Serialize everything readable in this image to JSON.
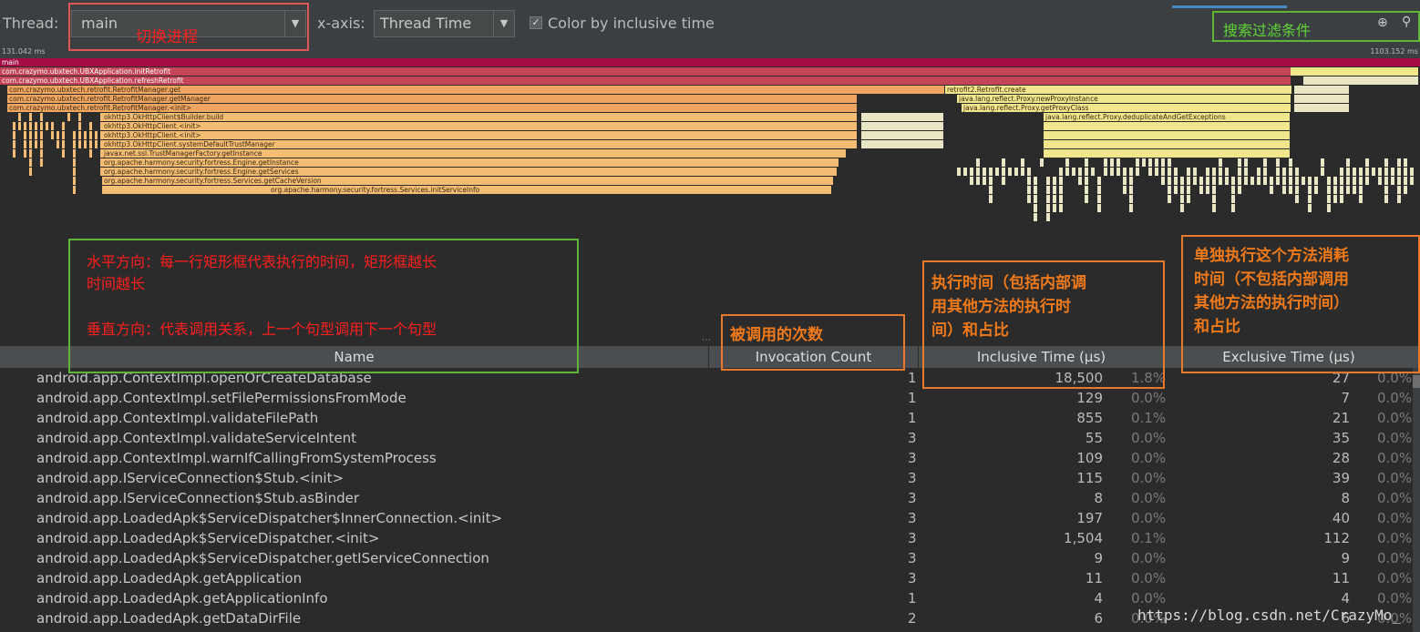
{
  "toolbar": {
    "thread_label": "Thread:",
    "thread_value": "main",
    "xaxis_label": "x-axis:",
    "xaxis_value": "Thread Time",
    "color_by_label": "Color by inclusive time",
    "color_by_checked": true
  },
  "ruler": {
    "start": "131.042 ms",
    "end": "1103.152 ms"
  },
  "annotations": {
    "switch_thread": "切换进程",
    "search_filter": "搜索过滤条件",
    "horizontal_line1": "水平方向：每一行矩形框代表执行的时间，矩形框越长",
    "horizontal_line2": "时间越长",
    "vertical_line": "垂直方向：代表调用关系，上一个句型调用下一个句型",
    "invocation_count": "被调用的次数",
    "inclusive_line1": "执行时间（包括内部调",
    "inclusive_line2": "用其他方法的执行时",
    "inclusive_line3": "间）和占比",
    "exclusive_line1": "单独执行这个方法消耗",
    "exclusive_line2": "时间（不包括内部调用",
    "exclusive_line3": "其他方法的执行时间）",
    "exclusive_line4": "和占比"
  },
  "colors": {
    "main": "#a50e45",
    "deep_red": "#c44458",
    "orange": "#f0a561",
    "light_orange": "#f5bd73",
    "yellow": "#f0e68c",
    "pale": "#e8e6c4",
    "accent_blue": "#4a88c7"
  },
  "flame": {
    "labels": [
      "main",
      "com.crazymo.ubxtech.UBXApplication.initRetrofit",
      "com.crazymo.ubxtech.UBXApplication.refreshRetrofit",
      "com.crazymo.ubxtech.retrofit.RetrofitManager.get",
      "com.crazymo.ubxtech.retrofit.RetrofitManager.getManager",
      "com.crazymo.ubxtech.retrofit.RetrofitManager.<init>",
      "okhttp3.OkHttpClient$Builder.build",
      "okhttp3.OkHttpClient.<init>",
      "okhttp3.OkHttpClient.<init>",
      "okhttp3.OkHttpClient.systemDefaultTrustManager",
      "javax.net.ssl.TrustManagerFactory.getInstance",
      "org.apache.harmony.security.fortress.Engine.getInstance",
      "org.apache.harmony.security.fortress.Engine.getServices",
      "org.apache.harmony.security.fortress.Services.getCacheVersion",
      "org.apache.harmony.security.fortress.Services.initServiceInfo",
      "retrofit2.Retrofit.create",
      "java.lang.reflect.Proxy.newProxyInstance",
      "java.lang.reflect.Proxy.getProxyClass",
      "java.lang.reflect.Proxy.deduplicateAndGetExceptions"
    ]
  },
  "table": {
    "headers": {
      "name": "Name",
      "invocation": "Invocation Count",
      "inclusive": "Inclusive Time (µs)",
      "exclusive": "Exclusive Time (µs)"
    },
    "rows": [
      {
        "name": "android.app.ContextImpl.openOrCreateDatabase",
        "count": "1",
        "inc": "18,500",
        "inc_pct": "1.8%",
        "exc": "27",
        "exc_pct": "0.0%"
      },
      {
        "name": "android.app.ContextImpl.setFilePermissionsFromMode",
        "count": "1",
        "inc": "129",
        "inc_pct": "0.0%",
        "exc": "7",
        "exc_pct": "0.0%"
      },
      {
        "name": "android.app.ContextImpl.validateFilePath",
        "count": "1",
        "inc": "855",
        "inc_pct": "0.1%",
        "exc": "21",
        "exc_pct": "0.0%"
      },
      {
        "name": "android.app.ContextImpl.validateServiceIntent",
        "count": "3",
        "inc": "55",
        "inc_pct": "0.0%",
        "exc": "35",
        "exc_pct": "0.0%"
      },
      {
        "name": "android.app.ContextImpl.warnIfCallingFromSystemProcess",
        "count": "3",
        "inc": "109",
        "inc_pct": "0.0%",
        "exc": "28",
        "exc_pct": "0.0%"
      },
      {
        "name": "android.app.IServiceConnection$Stub.<init>",
        "count": "3",
        "inc": "115",
        "inc_pct": "0.0%",
        "exc": "39",
        "exc_pct": "0.0%"
      },
      {
        "name": "android.app.IServiceConnection$Stub.asBinder",
        "count": "3",
        "inc": "8",
        "inc_pct": "0.0%",
        "exc": "8",
        "exc_pct": "0.0%"
      },
      {
        "name": "android.app.LoadedApk$ServiceDispatcher$InnerConnection.<init>",
        "count": "3",
        "inc": "197",
        "inc_pct": "0.0%",
        "exc": "40",
        "exc_pct": "0.0%"
      },
      {
        "name": "android.app.LoadedApk$ServiceDispatcher.<init>",
        "count": "3",
        "inc": "1,504",
        "inc_pct": "0.1%",
        "exc": "112",
        "exc_pct": "0.0%"
      },
      {
        "name": "android.app.LoadedApk$ServiceDispatcher.getIServiceConnection",
        "count": "3",
        "inc": "9",
        "inc_pct": "0.0%",
        "exc": "9",
        "exc_pct": "0.0%"
      },
      {
        "name": "android.app.LoadedApk.getApplication",
        "count": "3",
        "inc": "11",
        "inc_pct": "0.0%",
        "exc": "11",
        "exc_pct": "0.0%"
      },
      {
        "name": "android.app.LoadedApk.getApplicationInfo",
        "count": "1",
        "inc": "4",
        "inc_pct": "0.0%",
        "exc": "4",
        "exc_pct": "0.0%"
      },
      {
        "name": "android.app.LoadedApk.getDataDirFile",
        "count": "2",
        "inc": "6",
        "inc_pct": "0.0%",
        "exc": "6",
        "exc_pct": "0.0%"
      }
    ]
  },
  "watermark": "https://blog.csdn.net/CrazyMo_"
}
